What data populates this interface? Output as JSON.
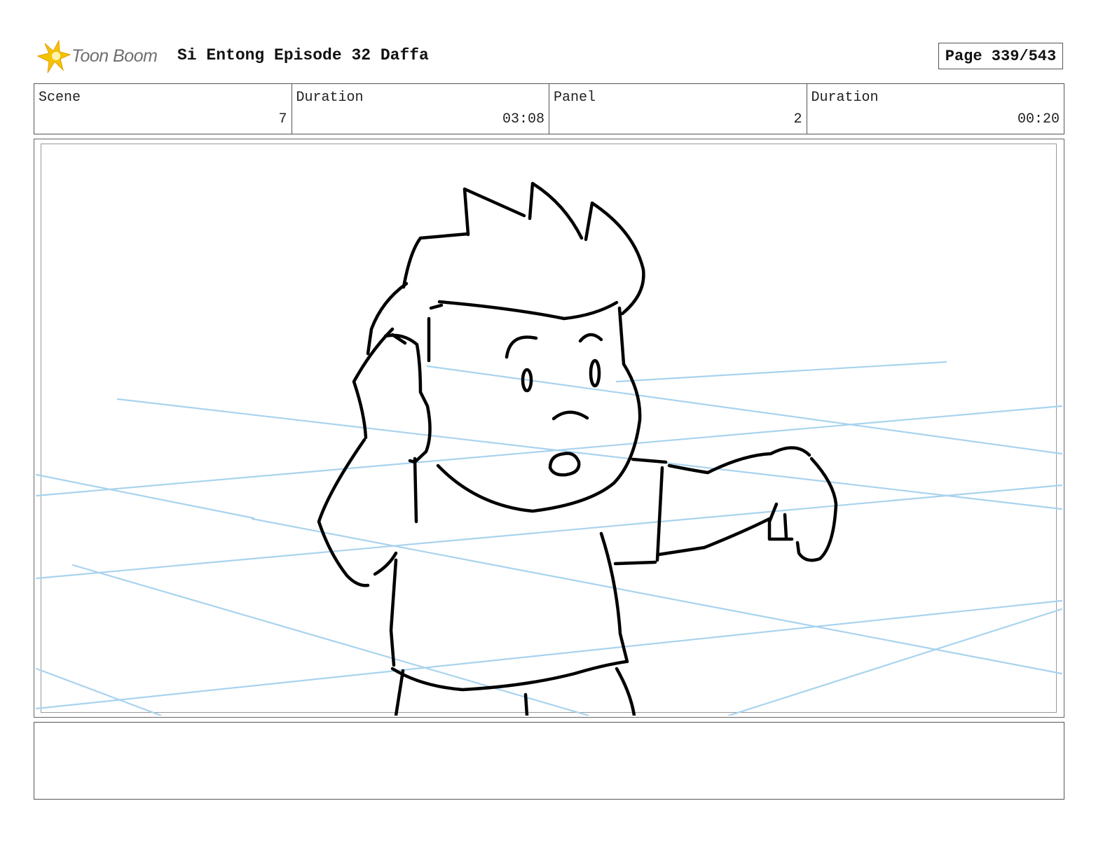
{
  "header": {
    "logo_text": "Toon Boom",
    "title": "Si Entong Episode 32 Daffa",
    "page": "Page 339/543"
  },
  "info": {
    "scene_label": "Scene",
    "scene_value": "7",
    "scene_duration_label": "Duration",
    "scene_duration_value": "03:08",
    "panel_label": "Panel",
    "panel_value": "2",
    "panel_duration_label": "Duration",
    "panel_duration_value": "00:20"
  },
  "colors": {
    "guide_lines": "#a9d3ee",
    "ink": "#000000",
    "logo_star": "#f5c400"
  },
  "notes": ""
}
